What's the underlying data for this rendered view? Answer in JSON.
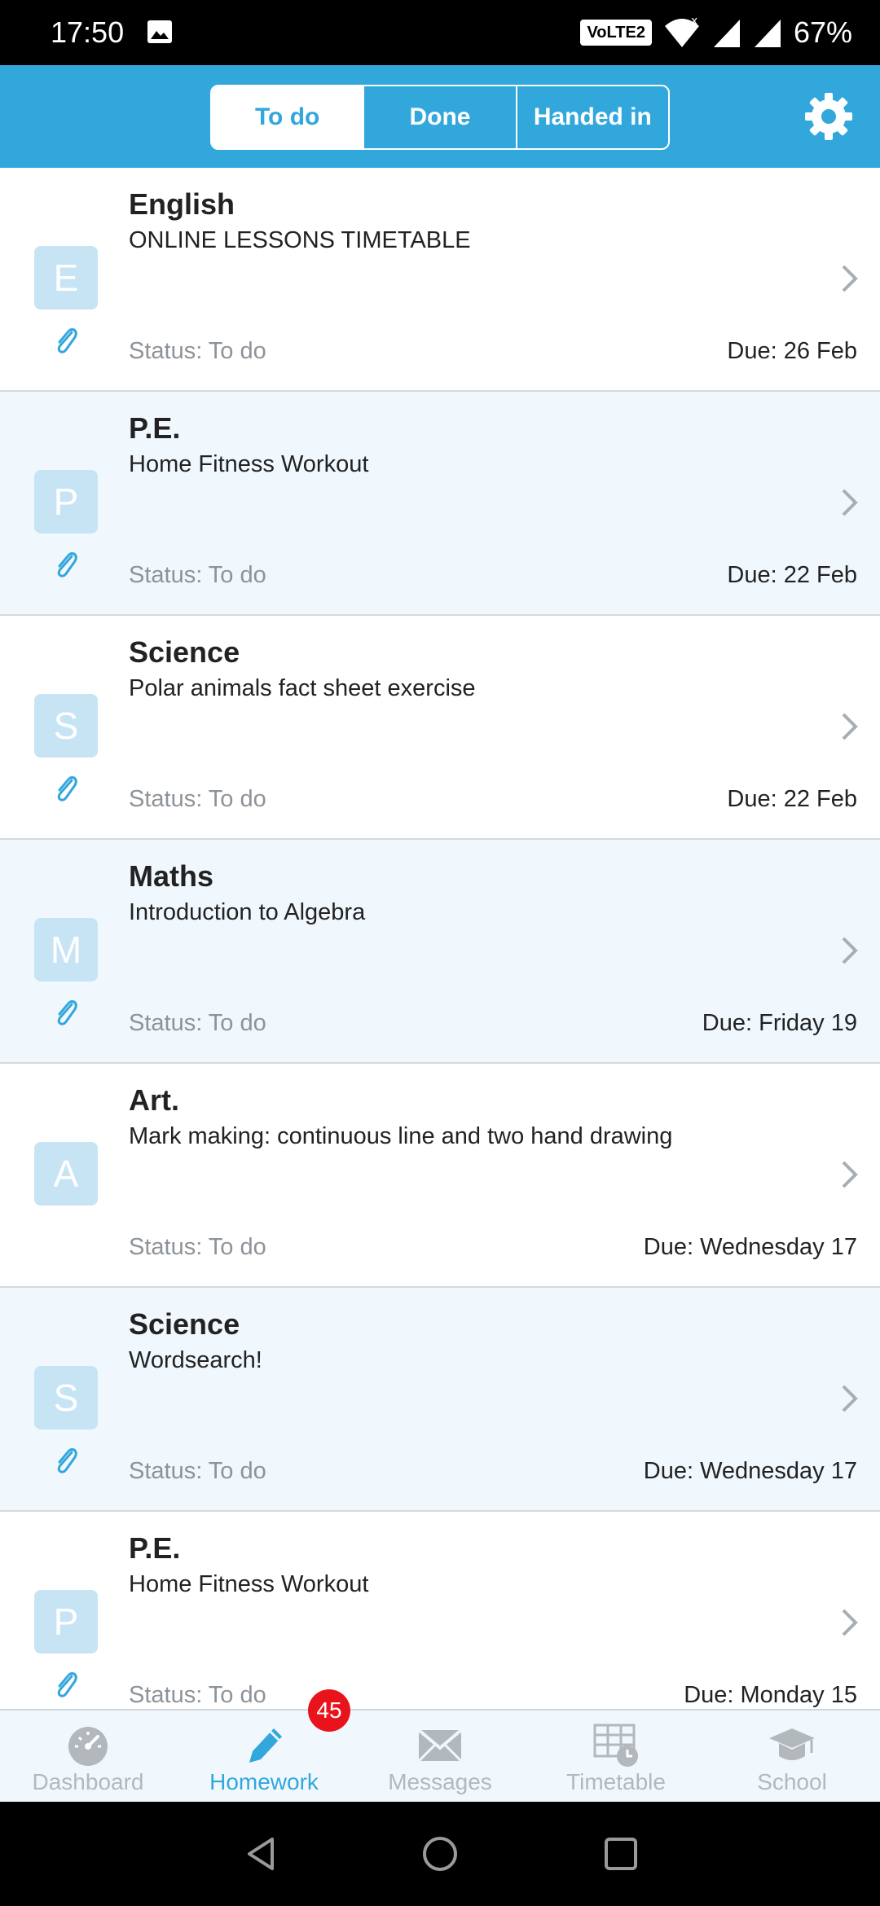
{
  "status_bar": {
    "time": "17:50",
    "network_badge": "VoLTE2",
    "battery": "67%",
    "icons": [
      "image-icon",
      "wifi-icon",
      "signal-icon",
      "battery-icon"
    ]
  },
  "header": {
    "tabs": [
      {
        "label": "To do",
        "active": true
      },
      {
        "label": "Done",
        "active": false
      },
      {
        "label": "Handed in",
        "active": false
      }
    ],
    "settings_icon": "gear-icon",
    "accent_color": "#32a7dc"
  },
  "homework": [
    {
      "letter": "E",
      "subject": "English",
      "description": "ONLINE LESSONS TIMETABLE",
      "status": "Status: To do",
      "due": "Due: 26 Feb",
      "attachment": true
    },
    {
      "letter": "P",
      "subject": "P.E.",
      "description": "Home Fitness Workout",
      "status": "Status: To do",
      "due": "Due: 22 Feb",
      "attachment": true
    },
    {
      "letter": "S",
      "subject": "Science",
      "description": "Polar animals fact sheet exercise",
      "status": "Status: To do",
      "due": "Due: 22 Feb",
      "attachment": true
    },
    {
      "letter": "M",
      "subject": "Maths",
      "description": "Introduction to Algebra",
      "status": "Status: To do",
      "due": "Due: Friday 19",
      "attachment": true
    },
    {
      "letter": "A",
      "subject": "Art.",
      "description": "Mark making: continuous line and two hand drawing",
      "status": "Status: To do",
      "due": "Due: Wednesday 17",
      "attachment": false
    },
    {
      "letter": "S",
      "subject": "Science",
      "description": "Wordsearch!",
      "status": "Status: To do",
      "due": "Due: Wednesday 17",
      "attachment": true
    },
    {
      "letter": "P",
      "subject": "P.E.",
      "description": "Home Fitness Workout",
      "status": "Status: To do",
      "due": "Due: Monday 15",
      "attachment": true
    }
  ],
  "bottom_nav": {
    "items": [
      {
        "label": "Dashboard",
        "icon": "dashboard-icon",
        "active": false
      },
      {
        "label": "Homework",
        "icon": "pencil-icon",
        "active": true
      },
      {
        "label": "Messages",
        "icon": "envelope-icon",
        "active": false
      },
      {
        "label": "Timetable",
        "icon": "timetable-icon",
        "active": false
      },
      {
        "label": "School",
        "icon": "graduation-cap-icon",
        "active": false
      }
    ],
    "homework_badge": "45",
    "badge_color": "#e9131c"
  },
  "system_nav": [
    "back-icon",
    "home-icon",
    "recents-icon"
  ]
}
